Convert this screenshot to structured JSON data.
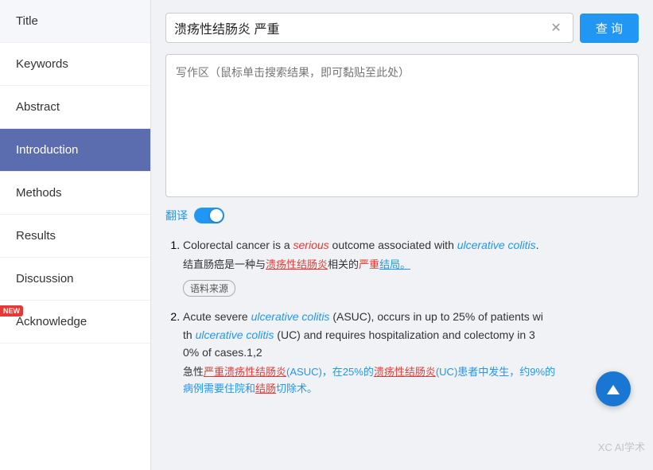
{
  "sidebar": {
    "items": [
      {
        "id": "title",
        "label": "Title",
        "active": false,
        "new": false
      },
      {
        "id": "keywords",
        "label": "Keywords",
        "active": false,
        "new": false
      },
      {
        "id": "abstract",
        "label": "Abstract",
        "active": false,
        "new": false
      },
      {
        "id": "introduction",
        "label": "Introduction",
        "active": true,
        "new": false
      },
      {
        "id": "methods",
        "label": "Methods",
        "active": false,
        "new": false
      },
      {
        "id": "results",
        "label": "Results",
        "active": false,
        "new": false
      },
      {
        "id": "discussion",
        "label": "Discussion",
        "active": false,
        "new": false
      },
      {
        "id": "acknowledge",
        "label": "Acknowledge",
        "active": false,
        "new": true
      }
    ]
  },
  "search": {
    "query": "溃疡性结肠炎 严重",
    "button_label": "查 询",
    "placeholder": "写作区（鼠标单击搜索结果，即可黏贴至此处）"
  },
  "translate": {
    "label": "翻译"
  },
  "results": [
    {
      "number": "1",
      "en": "Colorectal cancer is a serious outcome associated with ulcerative colitis.",
      "en_parts": [
        {
          "text": "Colorectal cancer is a ",
          "style": "normal"
        },
        {
          "text": "serious",
          "style": "italic-red"
        },
        {
          "text": " outcome associated with ",
          "style": "normal"
        },
        {
          "text": "ulcerative colitis",
          "style": "italic-blue"
        },
        {
          "text": ".",
          "style": "normal"
        }
      ],
      "cn": "结直肠癌是一种与溃疡性结肠炎相关的严重结局。",
      "cn_parts": [
        {
          "text": "结直肠癌是一种与",
          "style": "normal"
        },
        {
          "text": "溃疡性结肠炎",
          "style": "red-underline"
        },
        {
          "text": "相关的",
          "style": "normal"
        },
        {
          "text": "严重",
          "style": "red"
        },
        {
          "text": "结局。",
          "style": "blue-underline"
        }
      ],
      "source": "语料来源"
    },
    {
      "number": "2",
      "en": "Acute severe ulcerative colitis (ASUC), occurs in up to 25% of patients with ulcerative colitis (UC) and requires hospitalization and colectomy in 30% of cases.1,2",
      "en_parts": [
        {
          "text": "Acute severe ",
          "style": "normal"
        },
        {
          "text": "ulcerative colitis",
          "style": "italic-blue"
        },
        {
          "text": " (ASUC), occurs in up to 25% of patients wi\nth ",
          "style": "normal"
        },
        {
          "text": "ulcerative colitis",
          "style": "italic-blue"
        },
        {
          "text": " (UC) and requires hospitalization and colectomy in 3\n0% of cases.1,2",
          "style": "normal"
        }
      ],
      "cn": "急性严重溃疡性结肠炎(ASUC)，在25%的溃疡性结肠炎(UC)患者中发生，约9%的病例需要住院和结肠切除术。",
      "cn_parts": [
        {
          "text": "急性",
          "style": "normal"
        },
        {
          "text": "严重溃疡性结肠炎",
          "style": "red-underline"
        },
        {
          "text": "(ASUC)，在25%的",
          "style": "blue"
        },
        {
          "text": "溃疡性结肠炎",
          "style": "red-underline"
        },
        {
          "text": "(UC)患者中发生，约9%的\n病例需要住院和",
          "style": "blue"
        },
        {
          "text": "结肠",
          "style": "red-underline"
        },
        {
          "text": "切除术。",
          "style": "blue"
        }
      ]
    }
  ],
  "watermark": "XC AI学术"
}
